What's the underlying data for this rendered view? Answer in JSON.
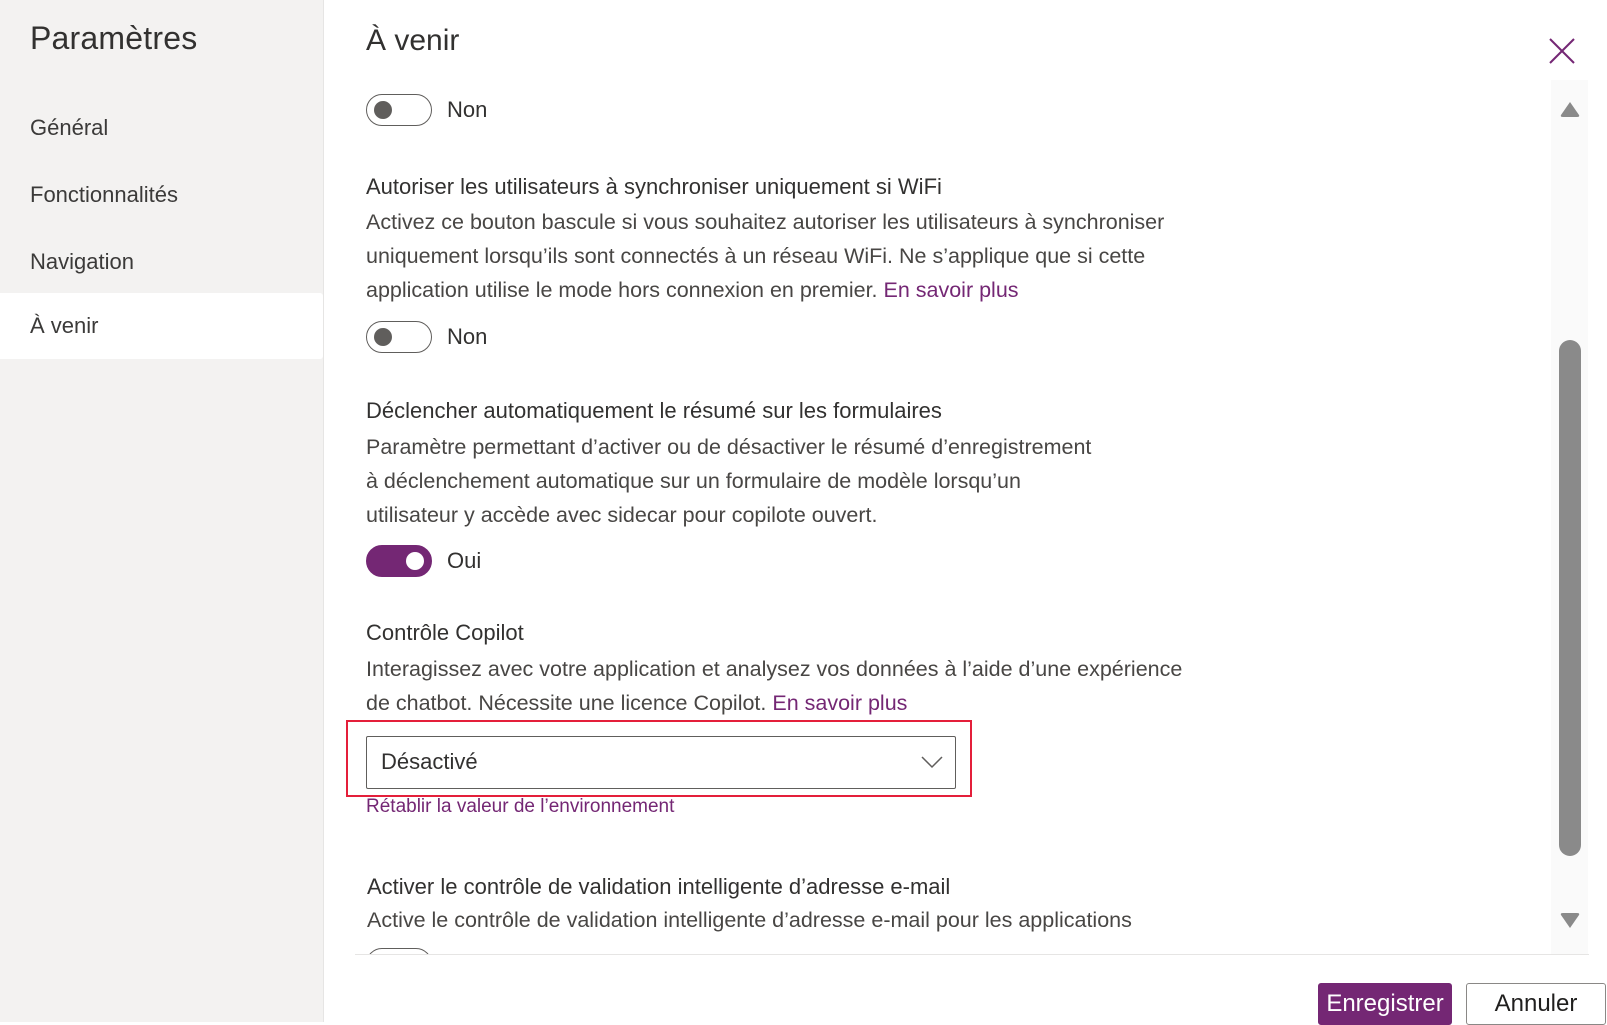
{
  "sidebar": {
    "title": "Paramètres",
    "items": [
      {
        "label": "Général",
        "selected": false
      },
      {
        "label": "Fonctionnalités",
        "selected": false
      },
      {
        "label": "Navigation",
        "selected": false
      },
      {
        "label": "À venir",
        "selected": true
      }
    ]
  },
  "header": {
    "title": "À venir",
    "close_icon": "close-icon"
  },
  "settings": {
    "top_toggle": {
      "state": "off",
      "label": "Non"
    },
    "wifi_sync": {
      "title": "Autoriser les utilisateurs à synchroniser uniquement si WiFi",
      "desc_lines": [
        "Activez ce bouton bascule si vous souhaitez autoriser les utilisateurs à synchroniser",
        "uniquement lorsqu’ils sont connectés à un réseau WiFi. Ne s’applique que si cette",
        "application utilise le mode hors connexion en premier. "
      ],
      "link": "En savoir plus",
      "toggle": {
        "state": "off",
        "label": "Non"
      }
    },
    "auto_summary": {
      "title": "Déclencher automatiquement le résumé sur les formulaires",
      "desc_lines": [
        "Paramètre permettant d’activer ou de désactiver le résumé d’enregistrement",
        "à déclenchement automatique sur un formulaire de modèle lorsqu’un",
        "utilisateur y accède avec sidecar pour copilote ouvert."
      ],
      "toggle": {
        "state": "on",
        "label": "Oui"
      }
    },
    "copilot_control": {
      "title": "Contrôle Copilot",
      "desc_lines": [
        "Interagissez avec votre application et analysez vos données à l’aide d’une expérience",
        "de chatbot. Nécessite une licence Copilot. "
      ],
      "link": "En savoir plus",
      "dropdown": {
        "selected": "Désactivé"
      },
      "reset_link": "Rétablir la valeur de l’environnement",
      "highlight_color": "#e41f3a"
    },
    "email_validation": {
      "title": "Activer le contrôle de validation intelligente d’adresse e-mail",
      "desc_lines": [
        "Active le contrôle de validation intelligente d’adresse e-mail pour les applications"
      ]
    }
  },
  "footer": {
    "save_label": "Enregistrer",
    "cancel_label": "Annuler"
  },
  "colors": {
    "accent": "#742774",
    "sidebar_bg": "#f3f2f1",
    "highlight": "#e41f3a"
  }
}
